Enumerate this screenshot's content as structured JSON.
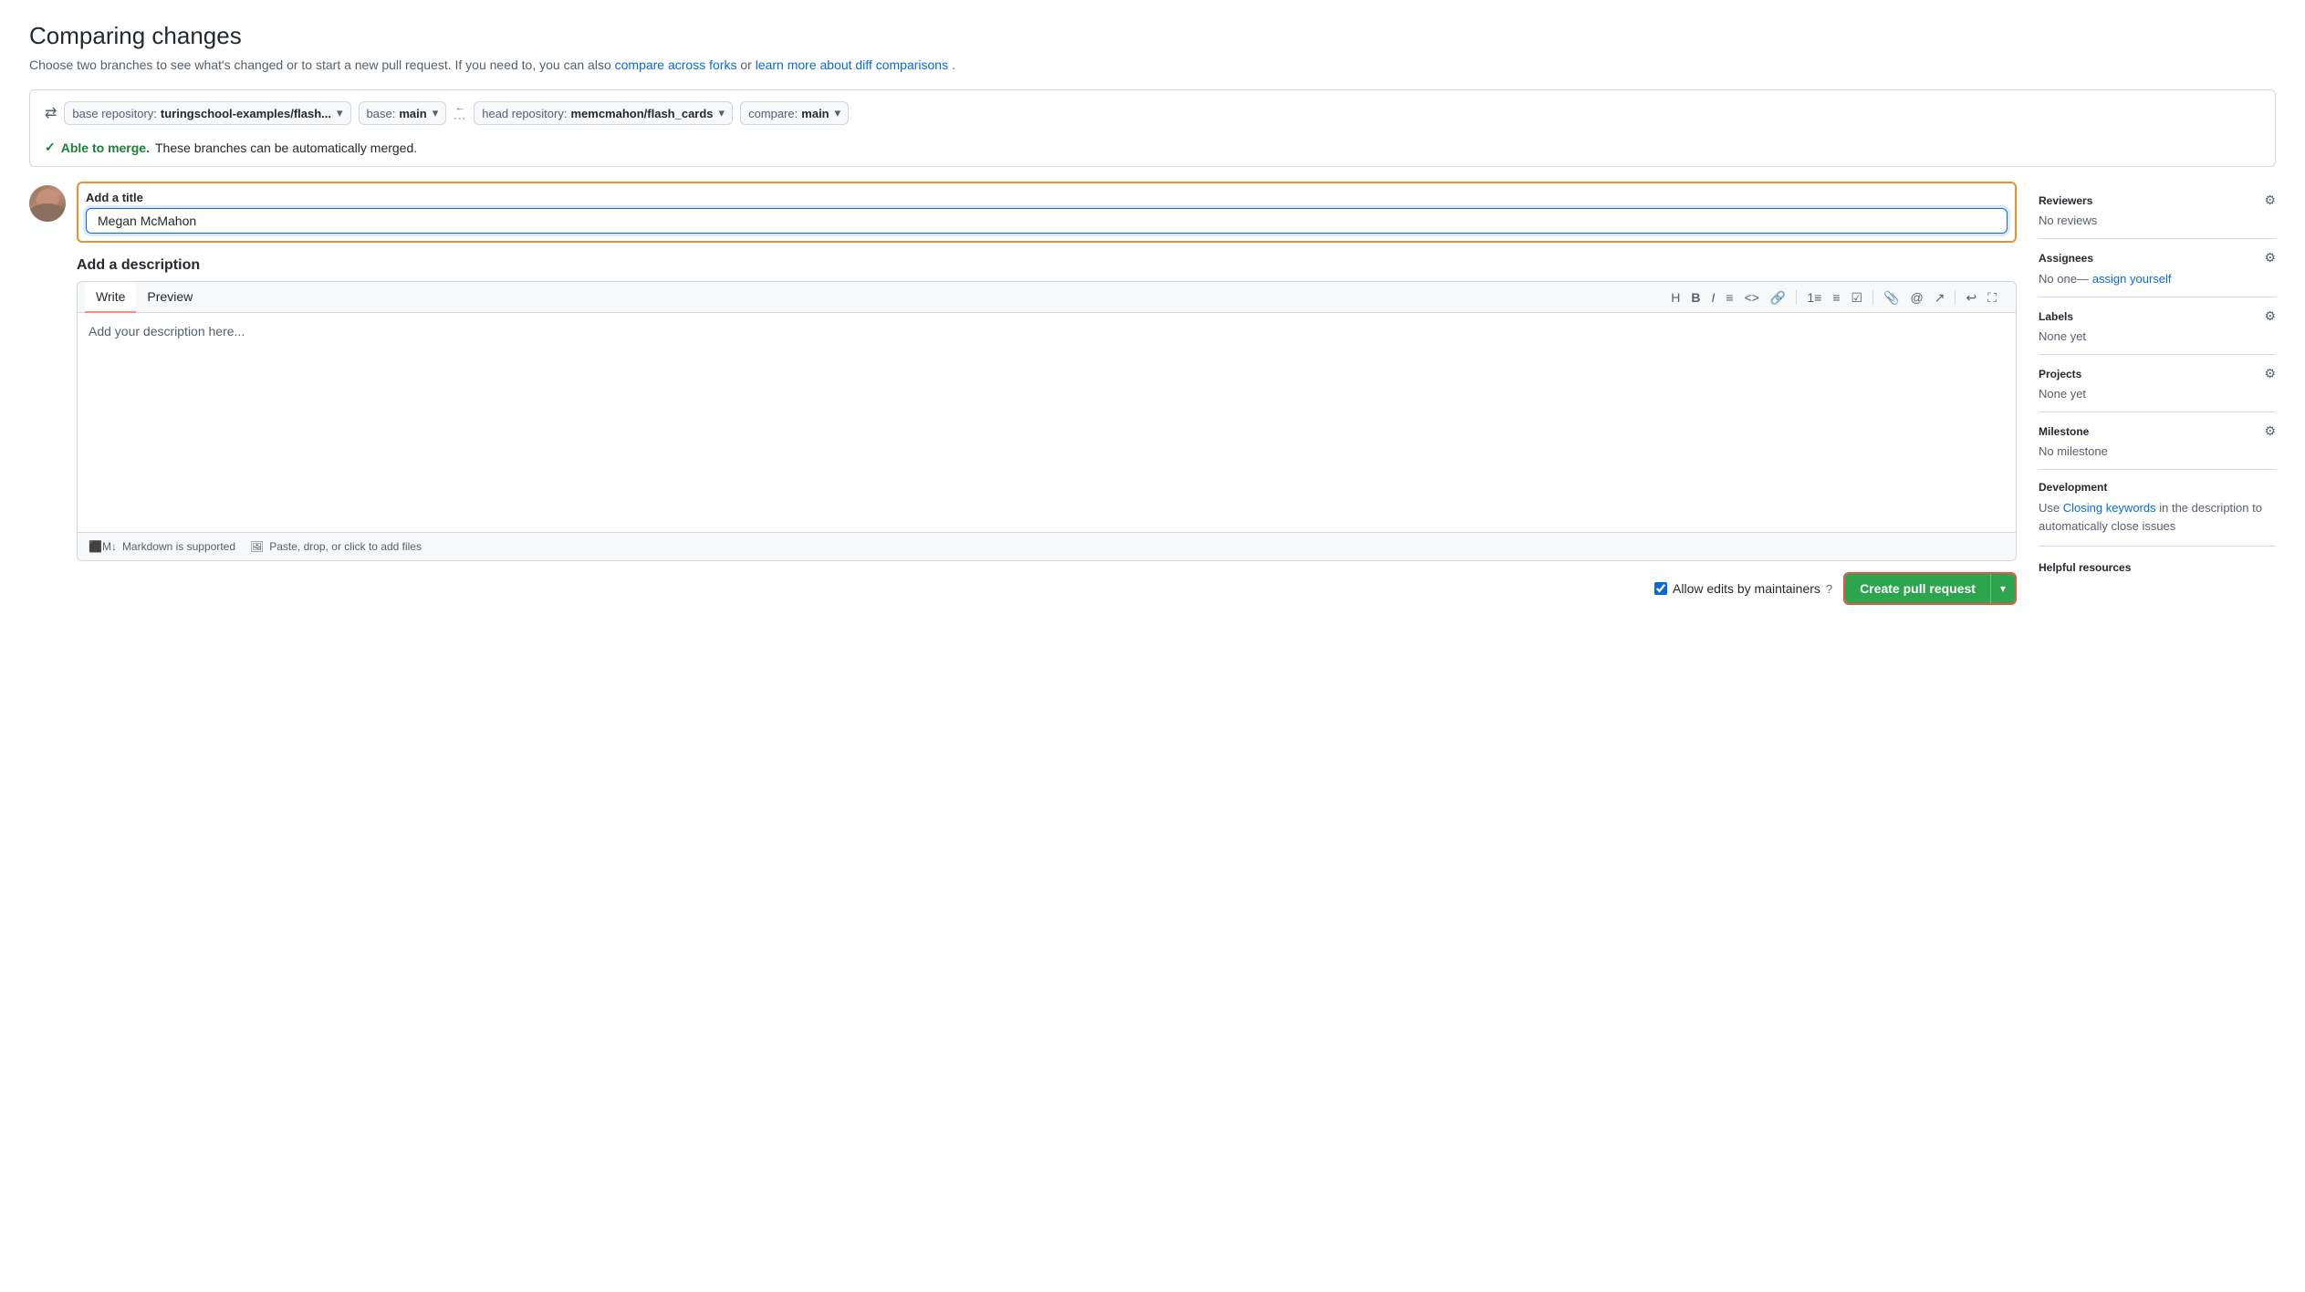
{
  "page": {
    "title": "Comparing changes",
    "subtitle_before": "Choose two branches to see what's changed or to start a new pull request. If you need to, you can also ",
    "compare_across_forks_link": "compare across forks",
    "subtitle_middle": " or ",
    "learn_about_link": "learn more about diff comparisons",
    "subtitle_after": "."
  },
  "branch_bar": {
    "base_repo_label": "base repository: ",
    "base_repo_value": "turingschool-examples/flash...",
    "base_label": "base: ",
    "base_value": "main",
    "head_repo_label": "head repository: ",
    "head_repo_value": "memcmahon/flash_cards",
    "compare_label": "compare: ",
    "compare_value": "main",
    "merge_check": "✓",
    "able_text": "Able to merge.",
    "merge_message": "These branches can be automatically merged."
  },
  "form": {
    "title_label": "Add a title",
    "title_value": "Megan McMahon",
    "title_placeholder": "Add a title",
    "description_label": "Add a description",
    "write_tab": "Write",
    "preview_tab": "Preview",
    "description_placeholder": "Add your description here...",
    "markdown_label": "Markdown is supported",
    "paste_label": "Paste, drop, or click to add files"
  },
  "toolbar": {
    "h": "H",
    "bold": "B",
    "italic": "I",
    "quote": "≡",
    "code": "<>",
    "link": "🔗",
    "numbered_list": "1.",
    "unordered_list": "•",
    "task_list": "☑",
    "attach": "📎",
    "mention": "@",
    "reference": "↗",
    "undo": "↩",
    "fullscreen": "⛶"
  },
  "actions": {
    "allow_edits_label": "Allow edits by maintainers",
    "create_button": "Create pull request",
    "dropdown_arrow": "▾"
  },
  "sidebar": {
    "reviewers": {
      "title": "Reviewers",
      "value": "No reviews"
    },
    "assignees": {
      "title": "Assignees",
      "value": "No one—",
      "link": "assign yourself"
    },
    "labels": {
      "title": "Labels",
      "value": "None yet"
    },
    "projects": {
      "title": "Projects",
      "value": "None yet"
    },
    "milestone": {
      "title": "Milestone",
      "value": "No milestone"
    },
    "development": {
      "title": "Development",
      "text_before": "Use ",
      "link": "Closing keywords",
      "text_after": " in the description to automatically close issues"
    },
    "helpful_resources": {
      "title": "Helpful resources"
    }
  }
}
